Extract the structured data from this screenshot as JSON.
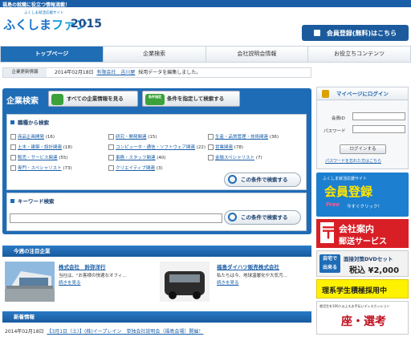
{
  "topbar": {
    "tagline": "福島の就職に役立つ情報満載！"
  },
  "logo": {
    "sub": "ふくしま就活応援サイト",
    "main_a": "ふくしま",
    "main_b": "ファン",
    "year": "2015"
  },
  "header": {
    "register": "会員登録(無料)はこちら"
  },
  "nav": [
    "トップページ",
    "企業検索",
    "会社説明会情報",
    "お役立ちコンテンツ"
  ],
  "update": {
    "label": "企業更新情報",
    "date": "2014年02月18日",
    "company": "有限会社　吉川屋",
    "text": "採用データを編集しました。"
  },
  "search": {
    "title": "企業検索",
    "all_btn": "すべての企業情報を見る",
    "cond_btn": "条件を指定して検索する",
    "cond_badge": "条件指定",
    "job_heading": "職種から検索",
    "jobs": [
      {
        "name": "商品企画開発",
        "count": "(16)"
      },
      {
        "name": "研究・開発関連",
        "count": "(15)"
      },
      {
        "name": "生産・品質管理・技術関連",
        "count": "(36)"
      },
      {
        "name": "土木・建築・設計関連",
        "count": "(18)"
      },
      {
        "name": "コンピュータ・通信・ソフトウェア関連",
        "count": "(22)"
      },
      {
        "name": "営業関連",
        "count": "(78)"
      },
      {
        "name": "販売・サービス関連",
        "count": "(55)"
      },
      {
        "name": "事務・スタッフ関連",
        "count": "(40)"
      },
      {
        "name": "金融スペシャリスト",
        "count": "(7)"
      },
      {
        "name": "専門・スペシャリスト",
        "count": "(73)"
      },
      {
        "name": "クリエイティブ関連",
        "count": "(3)"
      }
    ],
    "search_btn": "この条件で検索する",
    "keyword_heading": "キーワード検索",
    "keyword_value": ""
  },
  "featured": {
    "heading": "今週の注目企業",
    "items": [
      {
        "title": "株式会社　鈴弥洋行",
        "text": "当社は、\"お客様の快適なオフィ…",
        "more": "続きを見る"
      },
      {
        "title": "福島ダイハツ販売株式会社",
        "text": "私たちは今、地球温暖化や大気汚…",
        "more": "続きを見る"
      }
    ]
  },
  "news": {
    "heading": "新着情報",
    "date": "2014年02月18日",
    "text": "【3月1日（土）】(株)イープレイン　単独会社説明会（福島会場）開催！"
  },
  "login": {
    "title": "マイページにログイン",
    "id_label": "会員ID",
    "pw_label": "パスワード",
    "button": "ログインする",
    "forgot": "パスワードを忘れた方はこちら"
  },
  "banners": {
    "b1_sub": "ふくしま就活応援サイト",
    "b1_main": "会員登録",
    "b1_free": "Free",
    "b1_click": "今すぐクリック！",
    "b2_l1": "会社案内",
    "b2_l2": "郵送サービス",
    "b3_tag1": "自宅で",
    "b3_tag2": "出来る",
    "b3_title": "面接対策DVDセット",
    "b3_price": "税込 ¥2,000",
    "b4": "理系学生積極採用中",
    "b5_top": "就活生を100人以上もお手伝いディスカッション",
    "b5_main": "座・選考"
  },
  "colors": {
    "brand": "#1e6db5",
    "accent_red": "#d81f26",
    "green": "#3ba13b"
  }
}
